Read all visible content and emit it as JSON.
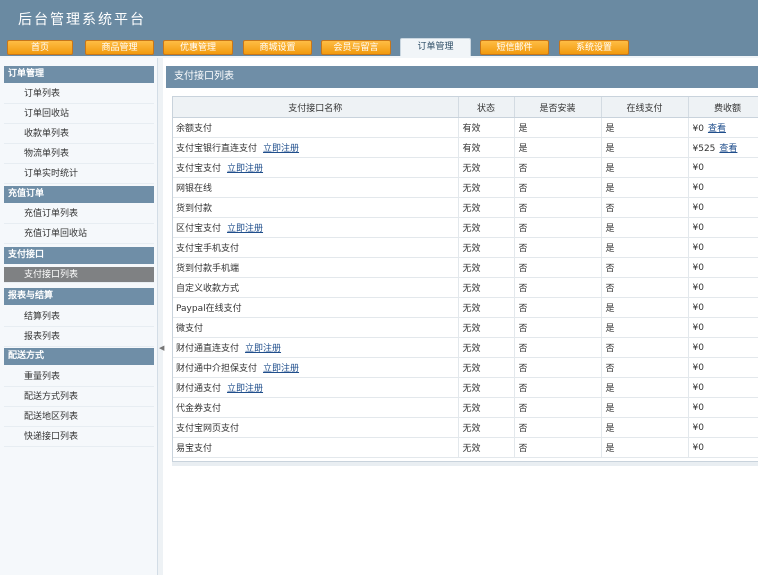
{
  "app": {
    "title": "后台管理系统平台"
  },
  "nav": {
    "tabs": [
      {
        "label": "首页"
      },
      {
        "label": "商品管理"
      },
      {
        "label": "优惠管理"
      },
      {
        "label": "商城设置"
      },
      {
        "label": "会员与留言"
      },
      {
        "label": "订单管理"
      },
      {
        "label": "短信邮件"
      },
      {
        "label": "系统设置"
      }
    ],
    "active_tab": "订单管理"
  },
  "sidebar": {
    "sections": [
      {
        "title": "订单管理",
        "items": [
          "订单列表",
          "订单回收站",
          "收款单列表",
          "物流单列表",
          "订单实时统计"
        ]
      },
      {
        "title": "充值订单",
        "items": [
          "充值订单列表",
          "充值订单回收站"
        ]
      },
      {
        "title": "支付接口",
        "items": [
          "支付接口列表"
        ]
      },
      {
        "title": "报表与结算",
        "items": [
          "结算列表",
          "报表列表"
        ]
      },
      {
        "title": "配送方式",
        "items": [
          "重量列表",
          "配送方式列表",
          "配送地区列表",
          "快递接口列表"
        ]
      }
    ],
    "active_item": "支付接口列表"
  },
  "main": {
    "panel_title": "支付接口列表",
    "table": {
      "headers": [
        "支付接口名称",
        "状态",
        "是否安装",
        "在线支付",
        "费收额"
      ],
      "link_label": "立即注册",
      "rows": [
        {
          "name": "余额支付",
          "status": "有效",
          "installed": "是",
          "online": "是",
          "fee": "¥0",
          "fee_link": "查看"
        },
        {
          "name": "支付宝银行直连支付",
          "link": "立即注册",
          "status": "有效",
          "installed": "是",
          "online": "是",
          "fee": "¥525",
          "fee_link": "查看"
        },
        {
          "name": "支付宝支付",
          "link": "立即注册",
          "status": "无效",
          "installed": "否",
          "online": "是",
          "fee": "¥0"
        },
        {
          "name": "网银在线",
          "status": "无效",
          "installed": "否",
          "online": "是",
          "fee": "¥0"
        },
        {
          "name": "货到付款",
          "status": "无效",
          "installed": "否",
          "online": "否",
          "fee": "¥0"
        },
        {
          "name": "区付宝支付",
          "link": "立即注册",
          "status": "无效",
          "installed": "否",
          "online": "是",
          "fee": "¥0"
        },
        {
          "name": "支付宝手机支付",
          "status": "无效",
          "installed": "否",
          "online": "是",
          "fee": "¥0"
        },
        {
          "name": "货到付款手机端",
          "status": "无效",
          "installed": "否",
          "online": "否",
          "fee": "¥0"
        },
        {
          "name": "自定义收款方式",
          "status": "无效",
          "installed": "否",
          "online": "否",
          "fee": "¥0"
        },
        {
          "name": "Paypal在线支付",
          "status": "无效",
          "installed": "否",
          "online": "是",
          "fee": "¥0"
        },
        {
          "name": "微支付",
          "status": "无效",
          "installed": "否",
          "online": "是",
          "fee": "¥0"
        },
        {
          "name": "财付通直连支付",
          "link": "立即注册",
          "status": "无效",
          "installed": "否",
          "online": "否",
          "fee": "¥0"
        },
        {
          "name": "财付通中介担保支付",
          "link": "立即注册",
          "status": "无效",
          "installed": "否",
          "online": "否",
          "fee": "¥0"
        },
        {
          "name": "财付通支付",
          "link": "立即注册",
          "status": "无效",
          "installed": "否",
          "online": "是",
          "fee": "¥0"
        },
        {
          "name": "代金券支付",
          "status": "无效",
          "installed": "否",
          "online": "是",
          "fee": "¥0"
        },
        {
          "name": "支付宝网页支付",
          "status": "无效",
          "installed": "否",
          "online": "是",
          "fee": "¥0"
        },
        {
          "name": "易宝支付",
          "status": "无效",
          "installed": "否",
          "online": "是",
          "fee": "¥0"
        }
      ]
    }
  },
  "colors": {
    "header_bg": "#6a8aa2",
    "tab_orange": "#f29a0e",
    "section_bg": "#6f8ea7",
    "active_item_bg": "#7f8183",
    "link": "#1f4e8c"
  }
}
